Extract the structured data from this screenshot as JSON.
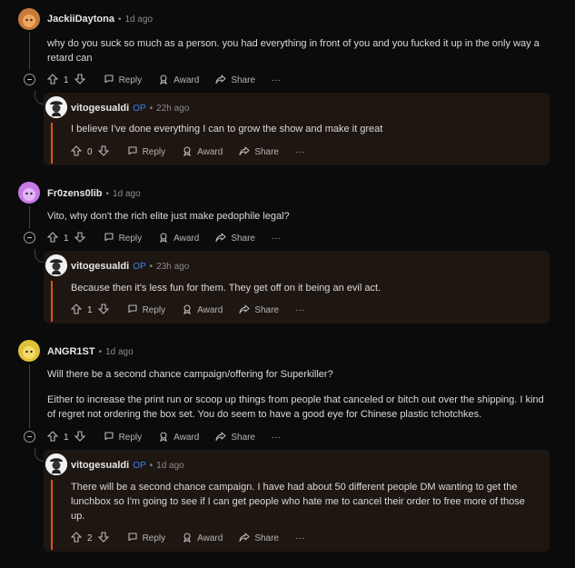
{
  "labels": {
    "reply": "Reply",
    "award": "Award",
    "share": "Share",
    "more": "···",
    "op": "OP"
  },
  "colors": {
    "op": "#3b82f6",
    "accent_bar": "#e2511e",
    "reply_bg": "#1e1611"
  },
  "threads": [
    {
      "comment": {
        "author": "JackiiDaytona",
        "time": "1d ago",
        "body": [
          "why do you suck so much as a person. you had everything in front of you and you fucked it up in the only way a retard can"
        ],
        "votes": "1",
        "avatar_color": "#c97b3c"
      },
      "reply": {
        "author": "vitogesualdi",
        "time": "22h ago",
        "body": [
          "I believe I've done everything I can to grow the show and make it great"
        ],
        "votes": "0"
      }
    },
    {
      "comment": {
        "author": "Fr0zens0lib",
        "time": "1d ago",
        "body": [
          "Vito, why don't the rich elite just make pedophile legal?"
        ],
        "votes": "1",
        "avatar_color": "#c77ae6"
      },
      "reply": {
        "author": "vitogesualdi",
        "time": "23h ago",
        "body": [
          "Because then it's less fun for them. They get off on it being an evil act."
        ],
        "votes": "1"
      }
    },
    {
      "comment": {
        "author": "ANGR1ST",
        "time": "1d ago",
        "body": [
          "Will there be a second chance campaign/offering for Superkiller?",
          "Either to increase the print run or scoop up things from people that canceled or bitch out over the shipping. I kind of regret not ordering the box set. You do seem to have a good eye for Chinese plastic tchotchkes."
        ],
        "votes": "1",
        "avatar_color": "#e0c13a"
      },
      "reply": {
        "author": "vitogesualdi",
        "time": "1d ago",
        "body": [
          "There will be a second chance campaign. I have had about 50 different people DM wanting to get the lunchbox so I'm going to see if I can get people who hate me to cancel their order to free more of those up."
        ],
        "votes": "2"
      }
    }
  ]
}
